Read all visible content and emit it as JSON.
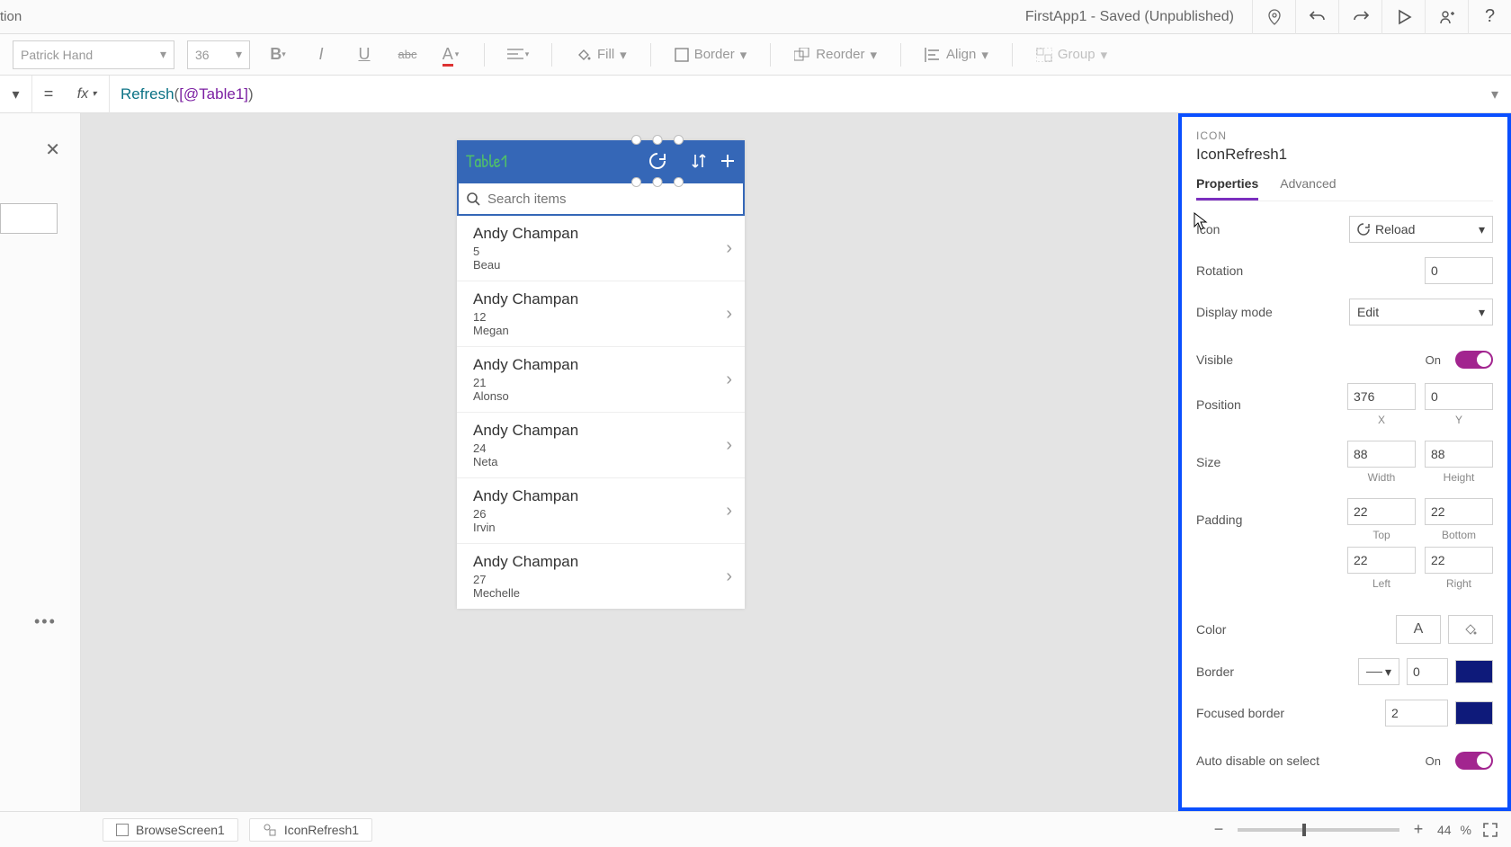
{
  "titlebar": {
    "left_word_fragment": "tion",
    "app_title": "FirstApp1 - Saved (Unpublished)"
  },
  "formatbar": {
    "font": "Patrick Hand",
    "size": "36",
    "fill_label": "Fill",
    "border_label": "Border",
    "reorder_label": "Reorder",
    "align_label": "Align",
    "group_label": "Group"
  },
  "formula": {
    "eq": "=",
    "fx": "fx",
    "fn": "Refresh",
    "open": "(",
    "ref": "[@Table1]",
    "close": ")"
  },
  "phone": {
    "title": "Table1",
    "search_placeholder": "Search items",
    "items": [
      {
        "name": "Andy Champan",
        "num": "5",
        "sub": "Beau"
      },
      {
        "name": "Andy Champan",
        "num": "12",
        "sub": "Megan"
      },
      {
        "name": "Andy Champan",
        "num": "21",
        "sub": "Alonso"
      },
      {
        "name": "Andy Champan",
        "num": "24",
        "sub": "Neta"
      },
      {
        "name": "Andy Champan",
        "num": "26",
        "sub": "Irvin"
      },
      {
        "name": "Andy Champan",
        "num": "27",
        "sub": "Mechelle"
      }
    ]
  },
  "properties": {
    "type_label": "ICON",
    "control_name": "IconRefresh1",
    "tab_properties": "Properties",
    "tab_advanced": "Advanced",
    "rows": {
      "icon_label": "Icon",
      "icon_value": "Reload",
      "rotation_label": "Rotation",
      "rotation_value": "0",
      "display_mode_label": "Display mode",
      "display_mode_value": "Edit",
      "visible_label": "Visible",
      "visible_on": "On",
      "position_label": "Position",
      "position_x": "376",
      "position_y": "0",
      "x_lbl": "X",
      "y_lbl": "Y",
      "size_label": "Size",
      "size_w": "88",
      "size_h": "88",
      "w_lbl": "Width",
      "h_lbl": "Height",
      "padding_label": "Padding",
      "pad_top": "22",
      "pad_bottom": "22",
      "pad_left": "22",
      "pad_right": "22",
      "top_lbl": "Top",
      "bottom_lbl": "Bottom",
      "left_lbl": "Left",
      "right_lbl": "Right",
      "color_label": "Color",
      "border_label": "Border",
      "border_width": "0",
      "focused_border_label": "Focused border",
      "focused_border_width": "2",
      "auto_disable_label": "Auto disable on select",
      "auto_disable_on": "On"
    }
  },
  "statusbar": {
    "screen": "BrowseScreen1",
    "control": "IconRefresh1",
    "zoom_value": "44",
    "zoom_unit": "%"
  },
  "colors": {
    "swatch": "#0e1a7a"
  }
}
